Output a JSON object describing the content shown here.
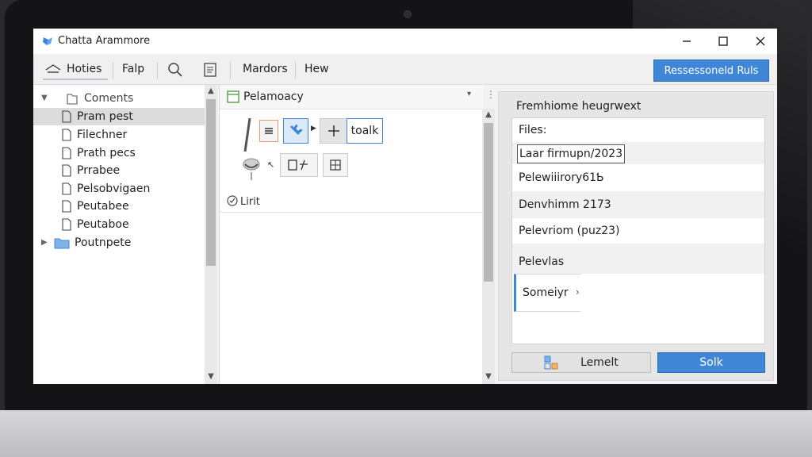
{
  "window": {
    "title": "Chatta Arammore"
  },
  "toolbar": {
    "home_label": "Hoties",
    "help_label": "Falp",
    "markers_label": "Mardors",
    "hew_label": "Hew",
    "primary_label": "Ressessoneld Ruls"
  },
  "tree": {
    "root_label": "Coments",
    "items": [
      {
        "label": "Pram pest"
      },
      {
        "label": "Filechner"
      },
      {
        "label": "Prath pecs"
      },
      {
        "label": "Prrabee"
      },
      {
        "label": "Pelsobvigaen"
      },
      {
        "label": "Peutabee"
      },
      {
        "label": "Peutaboe"
      }
    ],
    "folder_label": "Poutnpete"
  },
  "middle": {
    "title": "Pelamoacy",
    "tool_label": "toalk",
    "list_label": "Lirit"
  },
  "right": {
    "heading": "Fremhiome heugrwext",
    "files_label": "Files:",
    "field_value": "Laar firmupn/2023",
    "rows": [
      {
        "label": "Pelewiiirory61Ƅ"
      },
      {
        "label": "Denvhimm 2173"
      },
      {
        "label": "Pelevriom (puz23)"
      },
      {
        "label": "Pelevlas"
      }
    ],
    "selected_label": "Someiyr",
    "btn_secondary": "Lemelt",
    "btn_primary": "Solk"
  },
  "colors": {
    "accent": "#3f86d6",
    "bezel": "#141416"
  }
}
